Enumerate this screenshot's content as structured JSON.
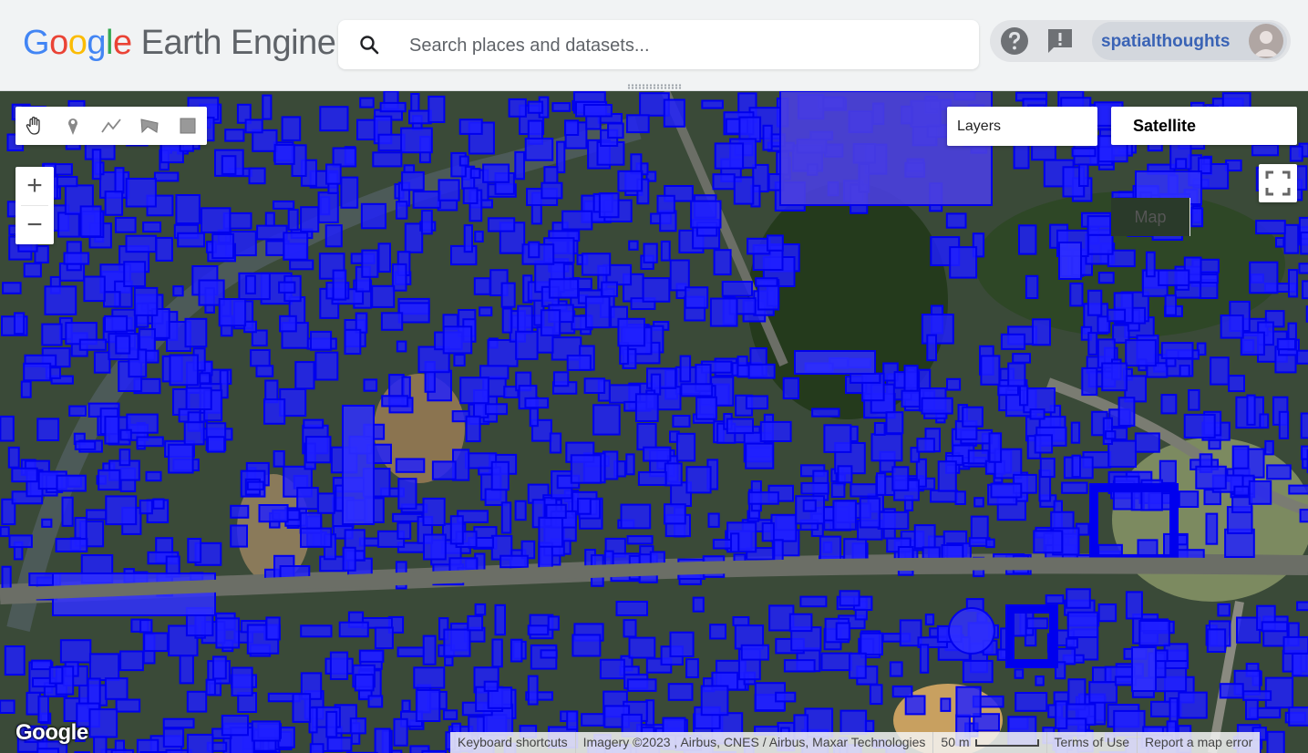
{
  "header": {
    "logo_google": "Google",
    "logo_product": "Earth Engine",
    "search_placeholder": "Search places and datasets...",
    "help_icon": "help-icon",
    "feedback_icon": "feedback-icon",
    "username": "spatialthoughts"
  },
  "map": {
    "drawing_tools": [
      "pan-hand-icon",
      "marker-icon",
      "line-icon",
      "polygon-icon",
      "rectangle-icon"
    ],
    "zoom_in": "+",
    "zoom_out": "−",
    "layers_label": "Layers",
    "map_type_map": "Map",
    "map_type_satellite": "Satellite",
    "selected_map_type": "Satellite",
    "google_logo": "Google",
    "footer": {
      "keyboard_shortcuts": "Keyboard shortcuts",
      "imagery": "Imagery ©2023 , Airbus, CNES / Airbus, Maxar Technologies",
      "scale": "50 m",
      "terms": "Terms of Use",
      "report": "Report a map error"
    },
    "colors": {
      "building_fill": "#2020ff",
      "building_stroke": "#0000ee",
      "vegetation": "#2f4a26",
      "road": "#6b6e66"
    }
  }
}
